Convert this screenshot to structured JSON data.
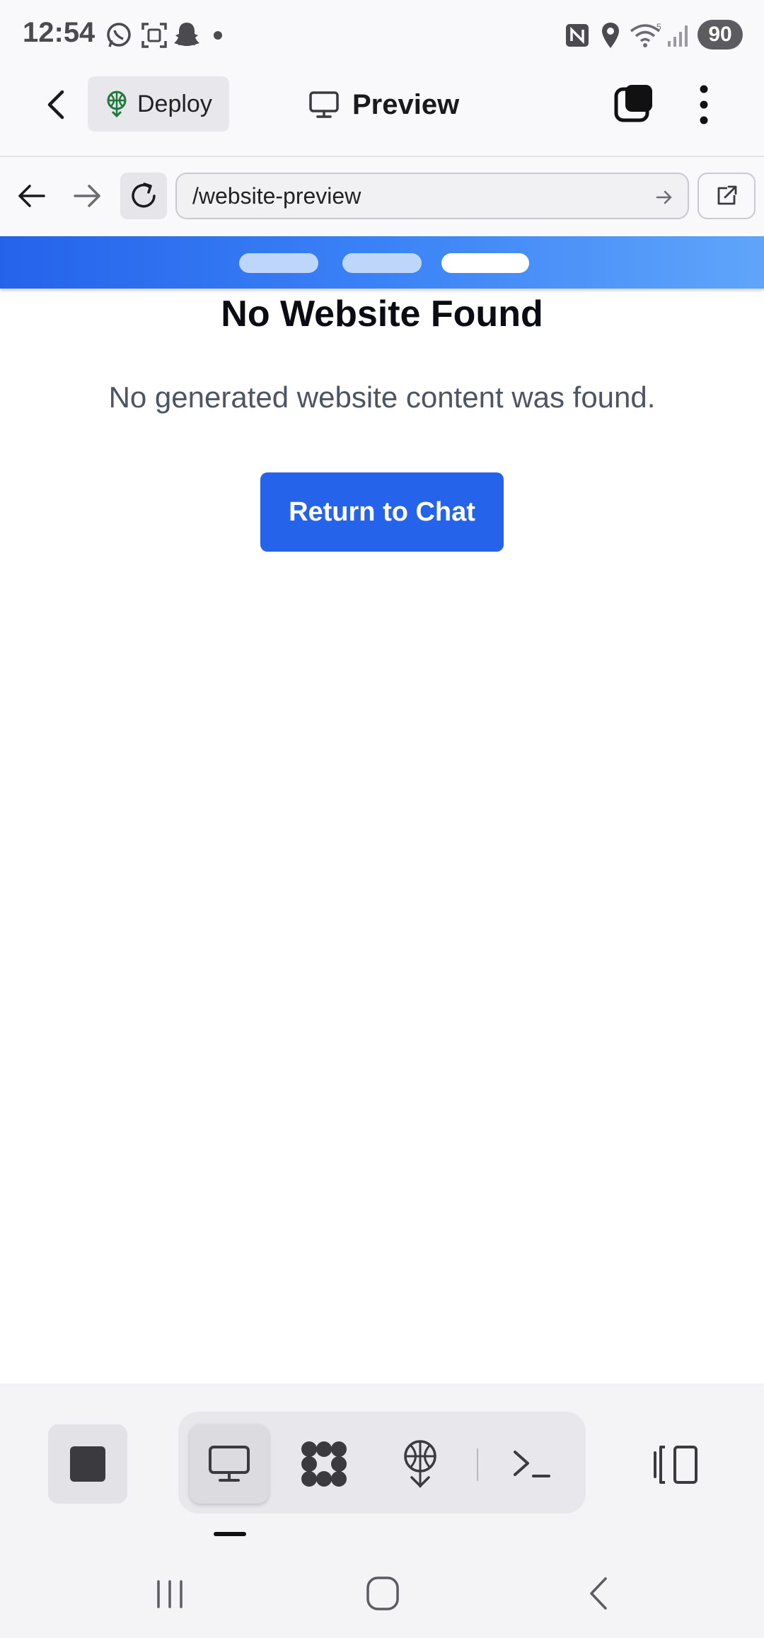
{
  "status_bar": {
    "time": "12:54",
    "battery": "90",
    "left_icons": [
      "whatsapp-icon",
      "screenshot-icon",
      "snapchat-icon",
      "dot-icon"
    ],
    "right_icons": [
      "nfc-icon",
      "location-icon",
      "wifi-icon",
      "signal-icon"
    ]
  },
  "app_bar": {
    "deploy_label": "Deploy",
    "title": "Preview"
  },
  "browser": {
    "url": "/website-preview"
  },
  "content": {
    "title": "No Website Found",
    "message": "No generated website content was found.",
    "button_label": "Return to Chat"
  },
  "colors": {
    "accent": "#2563eb",
    "banner_start": "#2563eb",
    "banner_end": "#60a5fa"
  }
}
